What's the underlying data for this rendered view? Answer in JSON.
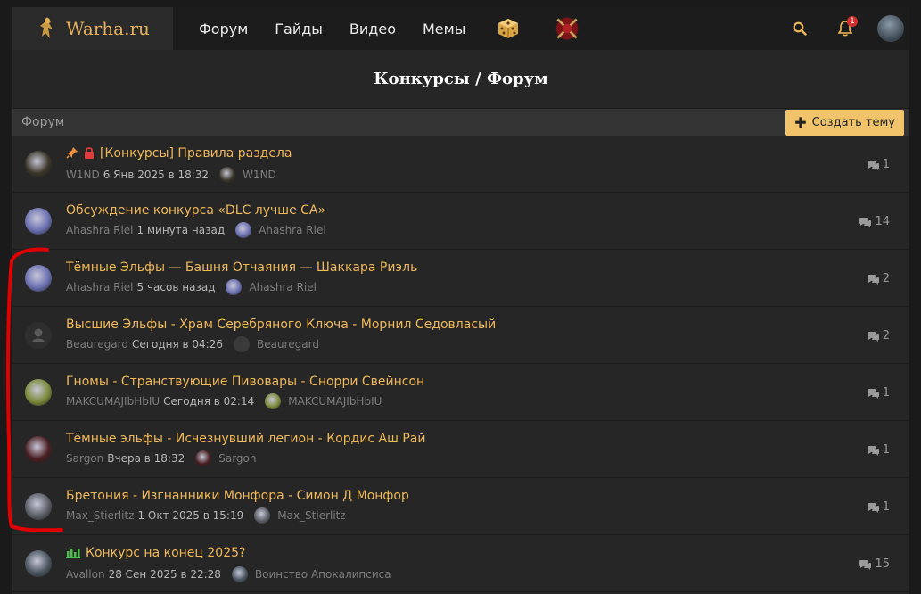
{
  "header": {
    "logo_text": "Warha.ru",
    "nav": [
      "Форум",
      "Гайды",
      "Видео",
      "Мемы"
    ],
    "notification_count": "1"
  },
  "page_title": "Конкурсы / Форум",
  "section": {
    "label": "Форум",
    "create_button": "Создать тему"
  },
  "threads": [
    {
      "title": "[Конкурсы] Правила раздела",
      "author": "W1ND",
      "date": "6 Янв 2025 в 18:32",
      "last_user": "W1ND",
      "replies": "1",
      "pinned": true,
      "locked": true,
      "avatar_color": "#3a3528"
    },
    {
      "title": "Обсуждение конкурса «DLC лучше CA»",
      "author": "Ahashra Riel",
      "date": "1 минута назад",
      "last_user": "Ahashra Riel",
      "replies": "14",
      "avatar_color": "#6a6fb0"
    },
    {
      "title": "Тёмные Эльфы — Башня Отчаяния — Шаккара Риэль",
      "author": "Ahashra Riel",
      "date": "5 часов назад",
      "last_user": "Ahashra Riel",
      "replies": "2",
      "avatar_color": "#6a6fb0"
    },
    {
      "title": "Высшие Эльфы - Храм Серебряного Ключа - Морнил Седовласый",
      "author": "Beauregard",
      "date": "Сегодня в 04:26",
      "last_user": "Beauregard",
      "replies": "2",
      "avatar_color": "#3a3a3a",
      "default_avatar": true
    },
    {
      "title": "Гномы - Странствующие Пивовары - Снорри Свейнсон",
      "author": "MAKCUMAJIbHbIU",
      "date": "Сегодня в 02:14",
      "last_user": "MAKCUMAJIbHbIU",
      "replies": "1",
      "avatar_color": "#7a8a3a"
    },
    {
      "title": "Тёмные эльфы - Исчезнувший легион - Кордис Аш Рай",
      "author": "Sargon",
      "date": "Вчера в 18:32",
      "last_user": "Sargon",
      "replies": "1",
      "avatar_color": "#4a1e22"
    },
    {
      "title": "Бретония - Изгнанники Монфора - Симон Д Монфор",
      "author": "Max_Stierlitz",
      "date": "1 Окт 2025 в 15:19",
      "last_user": "Max_Stierlitz",
      "replies": "1",
      "avatar_color": "#5a5e66"
    },
    {
      "title": "Конкурс на конец 2025?",
      "author": "Avallon",
      "date": "28 Сен 2025 в 22:28",
      "last_user": "Воинство Апокалипсиса",
      "replies": "15",
      "poll": true,
      "avatar_color": "#4a5560"
    }
  ],
  "colors": {
    "accent": "#f0b957",
    "button": "#f1c36a",
    "background": "#262626",
    "annotation_red": "#e00000"
  }
}
